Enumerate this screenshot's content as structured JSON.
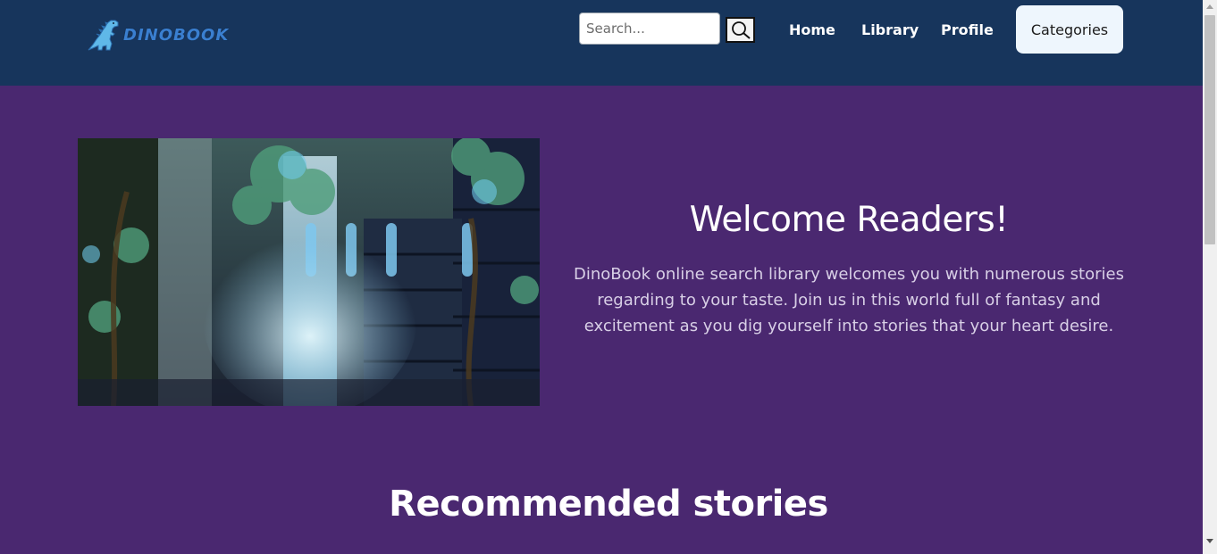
{
  "navbar": {
    "logo_text": "DINOBOOK",
    "search": {
      "placeholder": "Search...",
      "value": "",
      "icon": "search-icon"
    },
    "links": [
      {
        "label": "Home"
      },
      {
        "label": "Library"
      },
      {
        "label": "Profile"
      }
    ],
    "categories_label": "Categories"
  },
  "hero": {
    "image_subject": "fantasy library with tall windows and overgrown trees",
    "title": "Welcome Readers!",
    "text": "DinoBook online search library welcomes you with numerous stories regarding to your taste. Join us in this world full of fantasy and excitement as you dig yourself into stories that your heart desire."
  },
  "recommended": {
    "title": "Recommended stories"
  },
  "colors": {
    "navbar_bg": "#17355c",
    "page_bg": "#4a2870",
    "logo_blue": "#3a7fd0",
    "categories_bg": "#eef6fd"
  }
}
